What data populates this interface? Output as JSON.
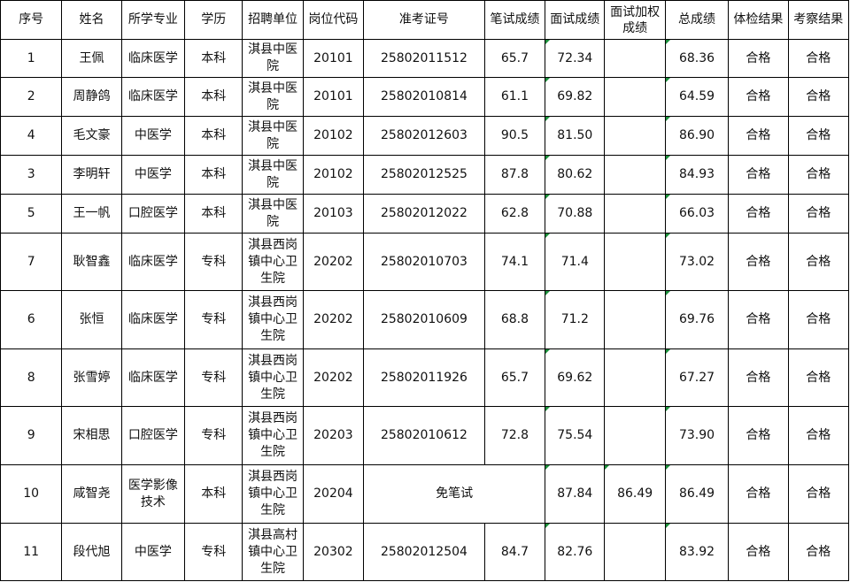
{
  "headers": [
    "序号",
    "姓名",
    "所学专业",
    "学历",
    "招聘单位",
    "岗位代码",
    "准考证号",
    "笔试成绩",
    "面试成绩",
    "面试加权成绩",
    "总成绩",
    "体检结果",
    "考察结果"
  ],
  "rows": [
    {
      "seq": "1",
      "name": "王佩",
      "major": "临床医学",
      "edu": "本科",
      "unit": "淇县中医院",
      "code": "20101",
      "ticket": "25802011512",
      "written": "65.7",
      "interview": "72.34",
      "weighted": "",
      "total": "68.36",
      "physical": "合格",
      "review": "合格"
    },
    {
      "seq": "2",
      "name": "周静鸽",
      "major": "临床医学",
      "edu": "本科",
      "unit": "淇县中医院",
      "code": "20101",
      "ticket": "25802010814",
      "written": "61.1",
      "interview": "69.82",
      "weighted": "",
      "total": "64.59",
      "physical": "合格",
      "review": "合格"
    },
    {
      "seq": "4",
      "name": "毛文豪",
      "major": "中医学",
      "edu": "本科",
      "unit": "淇县中医院",
      "code": "20102",
      "ticket": "25802012603",
      "written": "90.5",
      "interview": "81.50",
      "weighted": "",
      "total": "86.90",
      "physical": "合格",
      "review": "合格"
    },
    {
      "seq": "3",
      "name": "李明轩",
      "major": "中医学",
      "edu": "本科",
      "unit": "淇县中医院",
      "code": "20102",
      "ticket": "25802012525",
      "written": "87.8",
      "interview": "80.62",
      "weighted": "",
      "total": "84.93",
      "physical": "合格",
      "review": "合格"
    },
    {
      "seq": "5",
      "name": "王一帆",
      "major": "口腔医学",
      "edu": "本科",
      "unit": "淇县中医院",
      "code": "20103",
      "ticket": "25802012022",
      "written": "62.8",
      "interview": "70.88",
      "weighted": "",
      "total": "66.03",
      "physical": "合格",
      "review": "合格"
    },
    {
      "seq": "7",
      "name": "耿智鑫",
      "major": "临床医学",
      "edu": "专科",
      "unit": "淇县西岗镇中心卫生院",
      "code": "20202",
      "ticket": "25802010703",
      "written": "74.1",
      "interview": "71.4",
      "weighted": "",
      "total": "73.02",
      "physical": "合格",
      "review": "合格"
    },
    {
      "seq": "6",
      "name": "张恒",
      "major": "临床医学",
      "edu": "专科",
      "unit": "淇县西岗镇中心卫生院",
      "code": "20202",
      "ticket": "25802010609",
      "written": "68.8",
      "interview": "71.2",
      "weighted": "",
      "total": "69.76",
      "physical": "合格",
      "review": "合格"
    },
    {
      "seq": "8",
      "name": "张雪婷",
      "major": "临床医学",
      "edu": "专科",
      "unit": "淇县西岗镇中心卫生院",
      "code": "20202",
      "ticket": "25802011926",
      "written": "65.7",
      "interview": "69.62",
      "weighted": "",
      "total": "67.27",
      "physical": "合格",
      "review": "合格"
    },
    {
      "seq": "9",
      "name": "宋相思",
      "major": "口腔医学",
      "edu": "专科",
      "unit": "淇县西岗镇中心卫生院",
      "code": "20203",
      "ticket": "25802010612",
      "written": "72.8",
      "interview": "75.54",
      "weighted": "",
      "total": "73.90",
      "physical": "合格",
      "review": "合格"
    },
    {
      "seq": "10",
      "name": "咸智尧",
      "major": "医学影像技术",
      "edu": "本科",
      "unit": "淇县西岗镇中心卫生院",
      "code": "20204",
      "ticket": "免笔试",
      "written": "",
      "interview": "87.84",
      "weighted": "86.49",
      "total": "86.49",
      "physical": "合格",
      "review": "合格"
    },
    {
      "seq": "11",
      "name": "段代旭",
      "major": "中医学",
      "edu": "专科",
      "unit": "淇县高村镇中心卫生院",
      "code": "20302",
      "ticket": "25802012504",
      "written": "84.7",
      "interview": "82.76",
      "weighted": "",
      "total": "83.92",
      "physical": "合格",
      "review": "合格"
    }
  ],
  "colors": {
    "border": "#000000",
    "marker": "#1a8f3a"
  }
}
